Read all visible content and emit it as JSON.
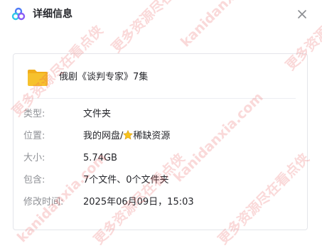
{
  "dialog": {
    "title": "详细信息"
  },
  "file": {
    "name": "俄剧《谈判专家》7集"
  },
  "details": {
    "type_label": "类型:",
    "type_value": "文件夹",
    "location_label": "位置:",
    "location_prefix": "我的网盘/",
    "location_suffix": "稀缺资源",
    "size_label": "大小:",
    "size_value": "5.74GB",
    "contains_label": "包含:",
    "contains_value": "7个文件、0个文件夹",
    "modified_label": "修改时间:",
    "modified_value": "2025年06月09日，15:03"
  },
  "watermarks": {
    "site": "kanidanxia.com",
    "slogan": "更多资源尽在看点侠"
  },
  "colors": {
    "folder": "#f6c12d",
    "folder_tab": "#f1ae1c",
    "star": "#f7c31d",
    "watermark": "#e85050"
  }
}
